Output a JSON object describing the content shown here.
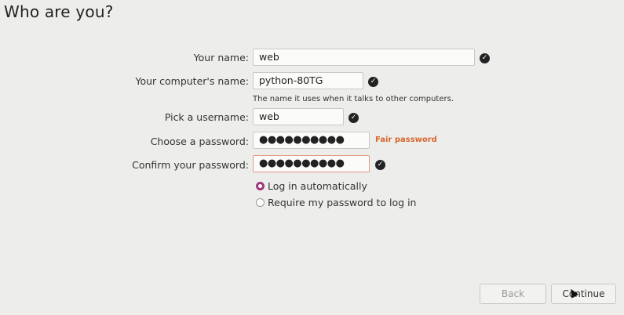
{
  "page": {
    "title": "Who are you?"
  },
  "form": {
    "name_label": "Your name:",
    "name_value": "web",
    "computer_label": "Your computer's name:",
    "computer_value": "python-80TG",
    "computer_hint": "The name it uses when it talks to other computers.",
    "username_label": "Pick a username:",
    "username_value": "web",
    "password_label": "Choose a password:",
    "password_value": "●●●●●●●●●●",
    "password_strength": "Fair password",
    "confirm_label": "Confirm your password:",
    "confirm_value": "●●●●●●●●●●"
  },
  "login": {
    "auto_label": "Log in automatically",
    "require_label": "Require my password to log in",
    "selected": "auto"
  },
  "buttons": {
    "back": "Back",
    "continue": "Continue"
  },
  "icons": {
    "check": "check-icon",
    "cursor": "mouse-pointer-icon"
  },
  "colors": {
    "accent": "#a0387e",
    "strength_text": "#d6662e",
    "focus_border": "#e29a83"
  }
}
